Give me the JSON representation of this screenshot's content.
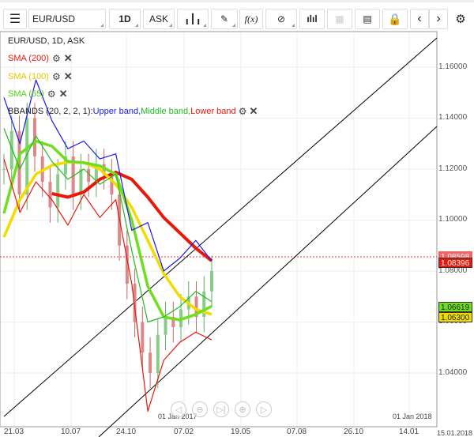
{
  "toolbar": {
    "symbol": "EUR/USD",
    "timeframe": "1D",
    "price_type": "ASK",
    "fx": "f(x)"
  },
  "legend": {
    "title": "EUR/USD, 1D, ASK",
    "sma200": "SMA (200)",
    "sma100": "SMA (100)",
    "sma55": "SMA (55)",
    "bbands_prefix": "BBANDS (20, 2, 2, 1): ",
    "upper": "Upper band, ",
    "middle": "Middle band, ",
    "lower": "Lower band"
  },
  "colors": {
    "sma200": "#e8180c",
    "sma100": "#f2dc00",
    "sma55": "#6fde1e",
    "upper": "#1a1af0",
    "middle": "#22bb22",
    "lower": "#e8180c"
  },
  "price_axis": [
    "1.16000",
    "1.14000",
    "1.12000",
    "1.10000",
    "1.08000",
    "1.06000",
    "1.04000"
  ],
  "price_tags": {
    "current": "1.08598",
    "sma200": "1.08396",
    "sma55": "1.06619",
    "sma100": "1.06300"
  },
  "time_axis": [
    "21.03",
    "10.07",
    "24.10",
    "07.02",
    "19.05",
    "07.08",
    "26.10",
    "14.01"
  ],
  "time_axis_end": "15.01.2018",
  "year_markers": [
    "01 Jan 2017",
    "01 Jan 2018"
  ],
  "chart_data": {
    "type": "line",
    "ylim": [
      1.02,
      1.18
    ],
    "current_price": 1.08598,
    "series": [
      {
        "name": "SMA (200)",
        "key": "sma200",
        "values": [
          null,
          null,
          null,
          1.1104,
          1.109,
          1.111,
          1.116,
          1.1188,
          1.116,
          1.109,
          1.101,
          1.095,
          1.089,
          1.084
        ]
      },
      {
        "name": "SMA (100)",
        "key": "sma100",
        "values": [
          1.0933,
          1.108,
          1.118,
          1.1215,
          1.1228,
          1.1225,
          1.12,
          1.114,
          1.105,
          1.092,
          1.079,
          1.07,
          1.065,
          1.063
        ]
      },
      {
        "name": "SMA (55)",
        "key": "sma55",
        "values": [
          1.1026,
          1.126,
          1.131,
          1.129,
          1.123,
          1.1225,
          1.1213,
          1.118,
          1.1,
          1.074,
          1.062,
          1.0608,
          1.063,
          1.0662
        ]
      },
      {
        "name": "Upper band",
        "key": "upper",
        "values": [
          1.1481,
          1.13,
          1.155,
          1.139,
          1.128,
          1.131,
          1.124,
          1.126,
          1.096,
          1.099,
          1.08,
          1.085,
          1.092,
          1.084
        ]
      },
      {
        "name": "Middle band",
        "key": "middle",
        "values": [
          1.136,
          1.12,
          1.133,
          1.123,
          1.116,
          1.12,
          1.114,
          1.118,
          1.088,
          1.06,
          1.062,
          1.066,
          1.072,
          1.068
        ]
      },
      {
        "name": "Lower band",
        "key": "lower",
        "values": [
          1.124,
          1.103,
          1.115,
          1.108,
          1.098,
          1.11,
          1.101,
          1.108,
          1.075,
          1.025,
          1.045,
          1.052,
          1.056,
          1.053
        ]
      }
    ],
    "closes": [
      1.12,
      1.135,
      1.11,
      1.14,
      1.125,
      1.115,
      1.105,
      1.118,
      1.125,
      1.11,
      1.12,
      1.115,
      1.122,
      1.118,
      1.11,
      1.09,
      1.075,
      1.06,
      1.048,
      1.04,
      1.055,
      1.062,
      1.058,
      1.065,
      1.07,
      1.062,
      1.072,
      1.08
    ]
  }
}
